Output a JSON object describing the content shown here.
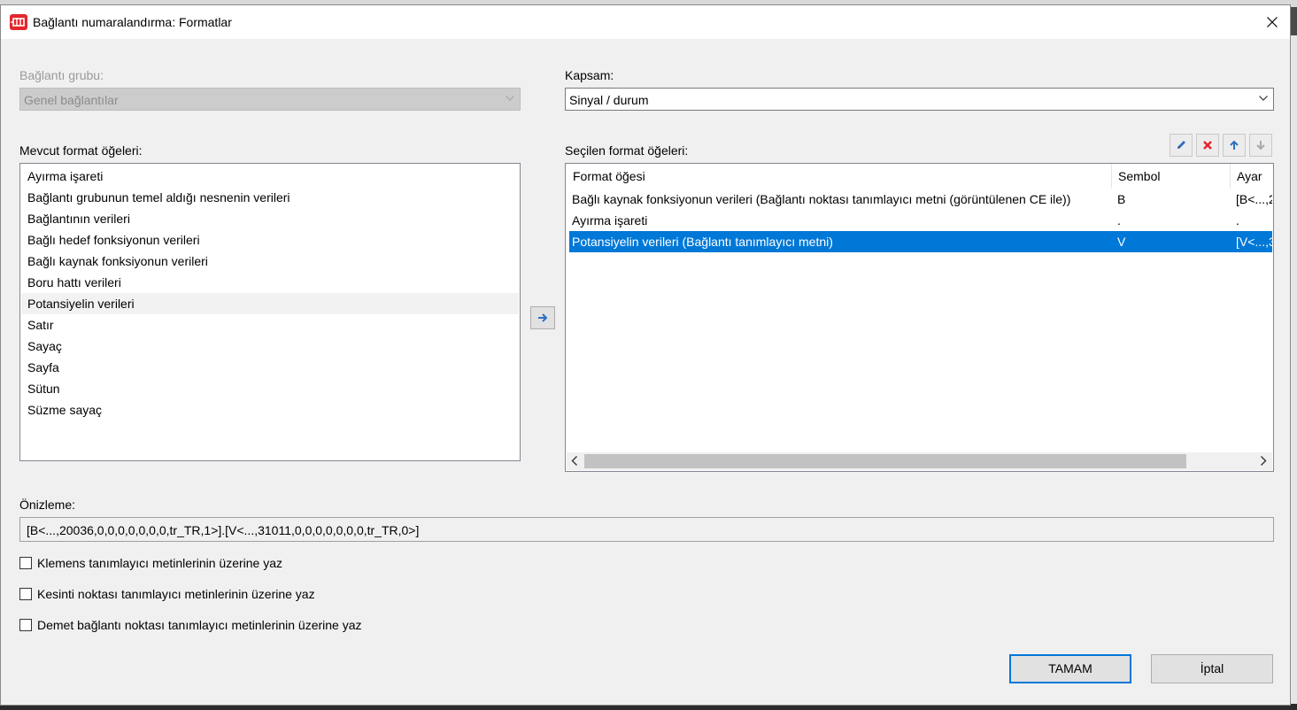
{
  "window": {
    "title": "Bağlantı numaralandırma: Formatlar",
    "icon": "connection-numbering-icon"
  },
  "connection_group": {
    "label": "Bağlantı grubu:",
    "value": "Genel bağlantılar",
    "enabled": false
  },
  "scope": {
    "label": "Kapsam:",
    "value": "Sinyal / durum"
  },
  "available": {
    "label": "Mevcut format öğeleri:",
    "items": [
      "Ayırma işareti",
      "Bağlantı grubunun temel aldığı nesnenin verileri",
      "Bağlantının verileri",
      "Bağlı hedef fonksiyonun verileri",
      "Bağlı kaynak fonksiyonun verileri",
      "Boru hattı verileri",
      "Potansiyelin verileri",
      "Satır",
      "Sayaç",
      "Sayfa",
      "Sütun",
      "Süzme sayaç"
    ],
    "hovered_index": 6
  },
  "selected": {
    "label": "Seçilen format öğeleri:",
    "columns": [
      "Format öğesi",
      "Sembol",
      "Ayar"
    ],
    "rows": [
      {
        "item": "Bağlı kaynak fonksiyonun verileri (Bağlantı noktası tanımlayıcı metni (görüntülenen CE ile))",
        "symbol": "B",
        "setting": "[B<...,2"
      },
      {
        "item": "Ayırma işareti",
        "symbol": ".",
        "setting": "."
      },
      {
        "item": "Potansiyelin verileri (Bağlantı tanımlayıcı metni)",
        "symbol": "V",
        "setting": "[V<...,3"
      }
    ],
    "selected_index": 2
  },
  "toolbar": {
    "edit": "pencil-icon",
    "delete": "delete-icon",
    "up": "arrow-up-icon",
    "down": "arrow-down-icon"
  },
  "preview": {
    "label": "Önizleme:",
    "value": "[B<...,20036,0,0,0,0,0,0,0,tr_TR,1>].[V<...,31011,0,0,0,0,0,0,0,tr_TR,0>]"
  },
  "options": [
    {
      "label": "Klemens tanımlayıcı metinlerinin üzerine yaz",
      "checked": false
    },
    {
      "label": "Kesinti noktası tanımlayıcı metinlerinin üzerine yaz",
      "checked": false
    },
    {
      "label": "Demet bağlantı noktası tanımlayıcı metinlerinin üzerine yaz",
      "checked": false
    }
  ],
  "buttons": {
    "ok": "TAMAM",
    "cancel": "İptal"
  },
  "colors": {
    "selection": "#0078d7",
    "delete_red": "#e3262d",
    "arrow_blue": "#2f6fbf"
  }
}
